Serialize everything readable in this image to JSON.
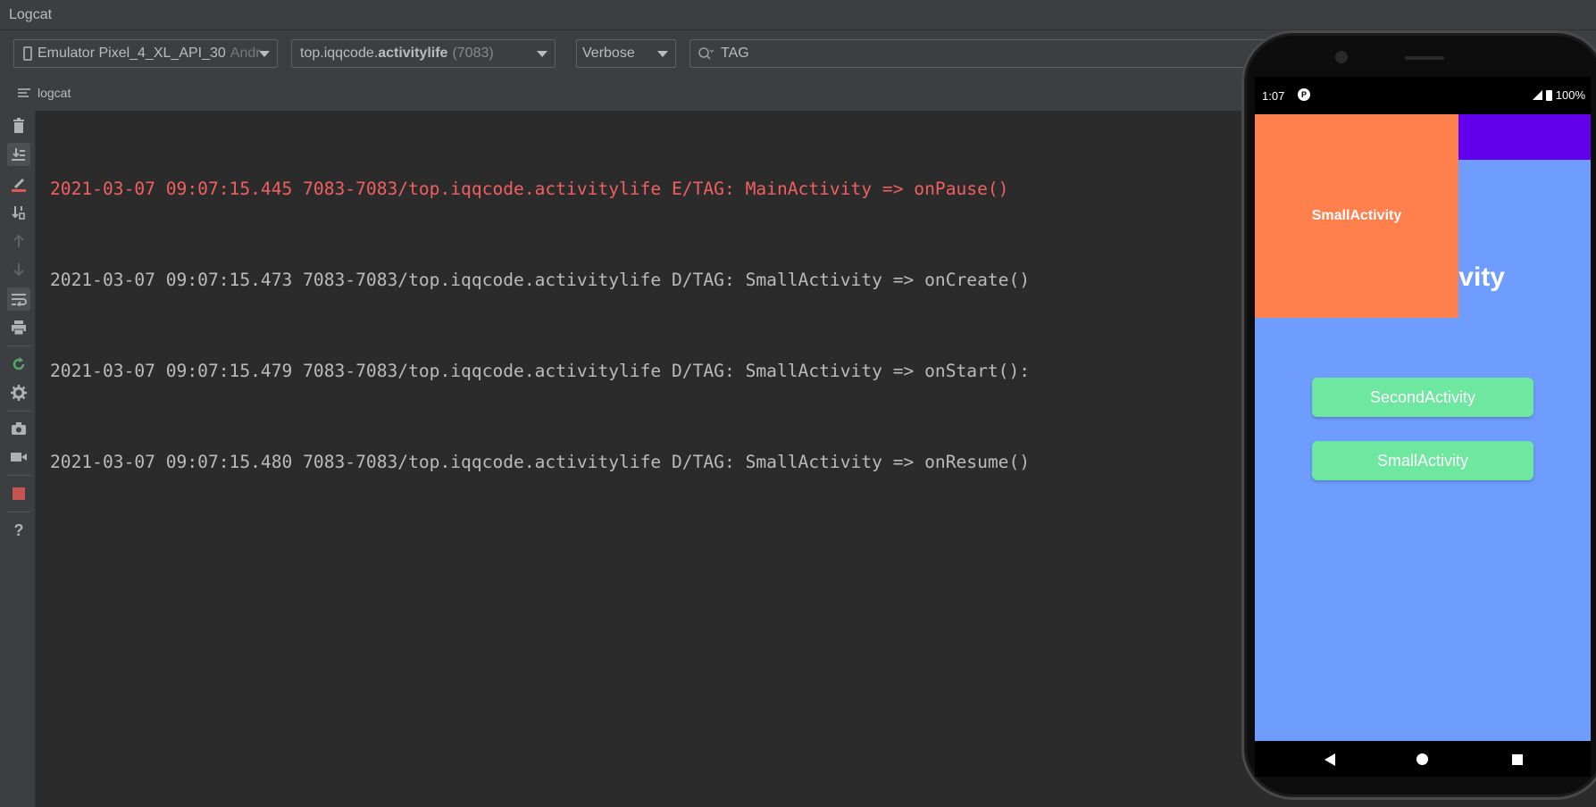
{
  "window": {
    "title": "Logcat"
  },
  "toolbar": {
    "device": {
      "name": "Emulator Pixel_4_XL_API_30",
      "suffix": "Andr"
    },
    "process": {
      "prefix": "top.iqqcode.",
      "bold": "activitylife",
      "pid": "(7083)"
    },
    "level": "Verbose",
    "search": {
      "value": "TAG"
    }
  },
  "tab": {
    "label": "logcat"
  },
  "sidebar": {
    "icons": [
      "trash-icon",
      "scroll-to-end-icon",
      "clear-logcat-icon",
      "sort-icon",
      "arrow-up-icon",
      "arrow-down-icon",
      "soft-wrap-icon",
      "print-icon",
      "restart-icon",
      "settings-icon",
      "screenshot-icon",
      "screen-record-icon",
      "stop-icon",
      "help-icon"
    ]
  },
  "log": {
    "lines": [
      {
        "text": "2021-03-07 09:07:15.445 7083-7083/top.iqqcode.activitylife E/TAG: MainActivity => onPause()",
        "level": "error"
      },
      {
        "text": "2021-03-07 09:07:15.473 7083-7083/top.iqqcode.activitylife D/TAG: SmallActivity => onCreate()",
        "level": "debug"
      },
      {
        "text": "2021-03-07 09:07:15.479 7083-7083/top.iqqcode.activitylife D/TAG: SmallActivity => onStart():",
        "level": "debug"
      },
      {
        "text": "2021-03-07 09:07:15.480 7083-7083/top.iqqcode.activitylife D/TAG: SmallActivity => onResume()",
        "level": "debug"
      }
    ]
  },
  "phone": {
    "status": {
      "time": "1:07",
      "battery": "100%"
    },
    "screen": {
      "main_title": "vity",
      "small_window_label": "SmallActivity",
      "buttons": [
        "SecondActivity",
        "SmallActivity"
      ]
    },
    "colors": {
      "background": "#6e9dff",
      "appbar": "#6200ee",
      "small_window": "#ff7f4d",
      "button": "#6ee7a0"
    }
  }
}
